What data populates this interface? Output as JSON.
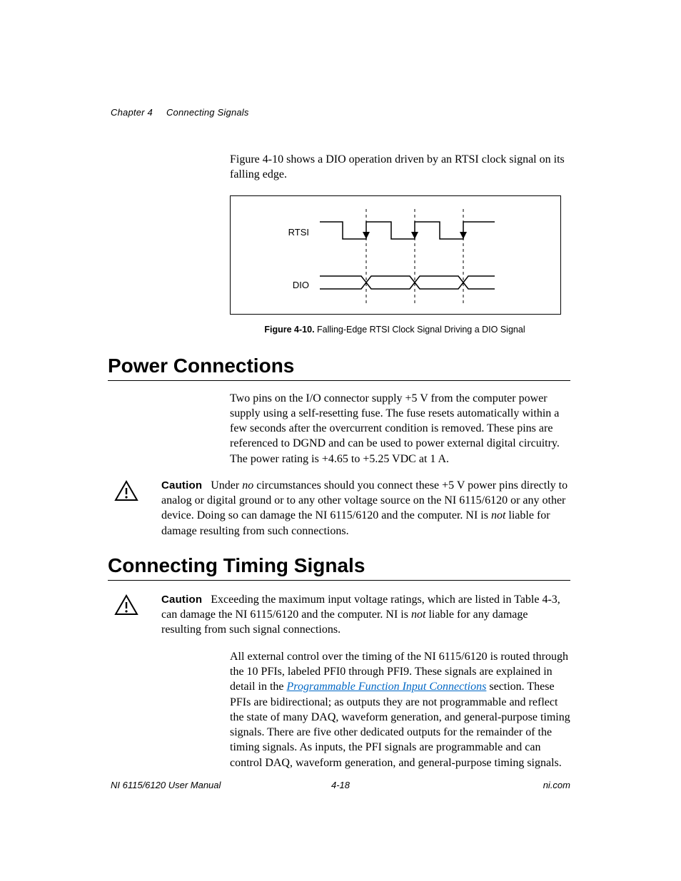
{
  "header": {
    "chapter": "Chapter 4",
    "title": "Connecting Signals"
  },
  "intro": {
    "text": "Figure 4-10 shows a DIO operation driven by an RTSI clock signal on its falling edge."
  },
  "figure": {
    "labels": {
      "rtsi": "RTSI",
      "dio": "DIO"
    },
    "caption_bold": "Figure 4-10.",
    "caption_rest": "  Falling-Edge RTSI Clock Signal Driving a DIO Signal"
  },
  "section1": {
    "heading": "Power Connections",
    "para": "Two pins on the I/O connector supply +5 V from the computer power supply using a self-resetting fuse. The fuse resets automatically within a few seconds after the overcurrent condition is removed. These pins are referenced to DGND and can be used to power external digital circuitry. The power rating is +4.65 to +5.25 VDC at 1 A.",
    "caution_kw": "Caution",
    "caution_1": "Under ",
    "caution_no": "no",
    "caution_2": " circumstances should you connect these +5 V power pins directly to analog or digital ground or to any other voltage source on the NI 6115/6120 or any other device. Doing so can damage the NI 6115/6120 and the computer. NI is ",
    "caution_not": "not",
    "caution_3": " liable for damage resulting from such connections."
  },
  "section2": {
    "heading": "Connecting Timing Signals",
    "caution_kw": "Caution",
    "caution_1": "Exceeding the maximum input voltage ratings, which are listed in Table 4-3, can damage the NI 6115/6120 and the computer. NI is ",
    "caution_not": "not",
    "caution_2": " liable for any damage resulting from such signal connections.",
    "para_1": "All external control over the timing of the NI 6115/6120 is routed through the 10 PFIs, labeled PFI0 through PFI9. These signals are explained in detail in the ",
    "para_link": "Programmable Function Input Connections",
    "para_2": " section. These PFIs are bidirectional; as outputs they are not programmable and reflect the state of many DAQ, waveform generation, and general-purpose timing signals. There are five other dedicated outputs for the remainder of the timing signals. As inputs, the PFI signals are programmable and can control DAQ, waveform generation, and general-purpose timing signals."
  },
  "footer": {
    "left": "NI 6115/6120 User Manual",
    "center": "4-18",
    "right": "ni.com"
  },
  "chart_data": {
    "type": "timing-diagram",
    "signals": [
      {
        "name": "RTSI",
        "edges_shown": 3,
        "driving_edge": "falling"
      },
      {
        "name": "DIO",
        "transitions_at_rtsi_fall": true
      }
    ],
    "dashed_vertical_guides": 3,
    "note": "DIO changes state on each falling edge of RTSI"
  }
}
